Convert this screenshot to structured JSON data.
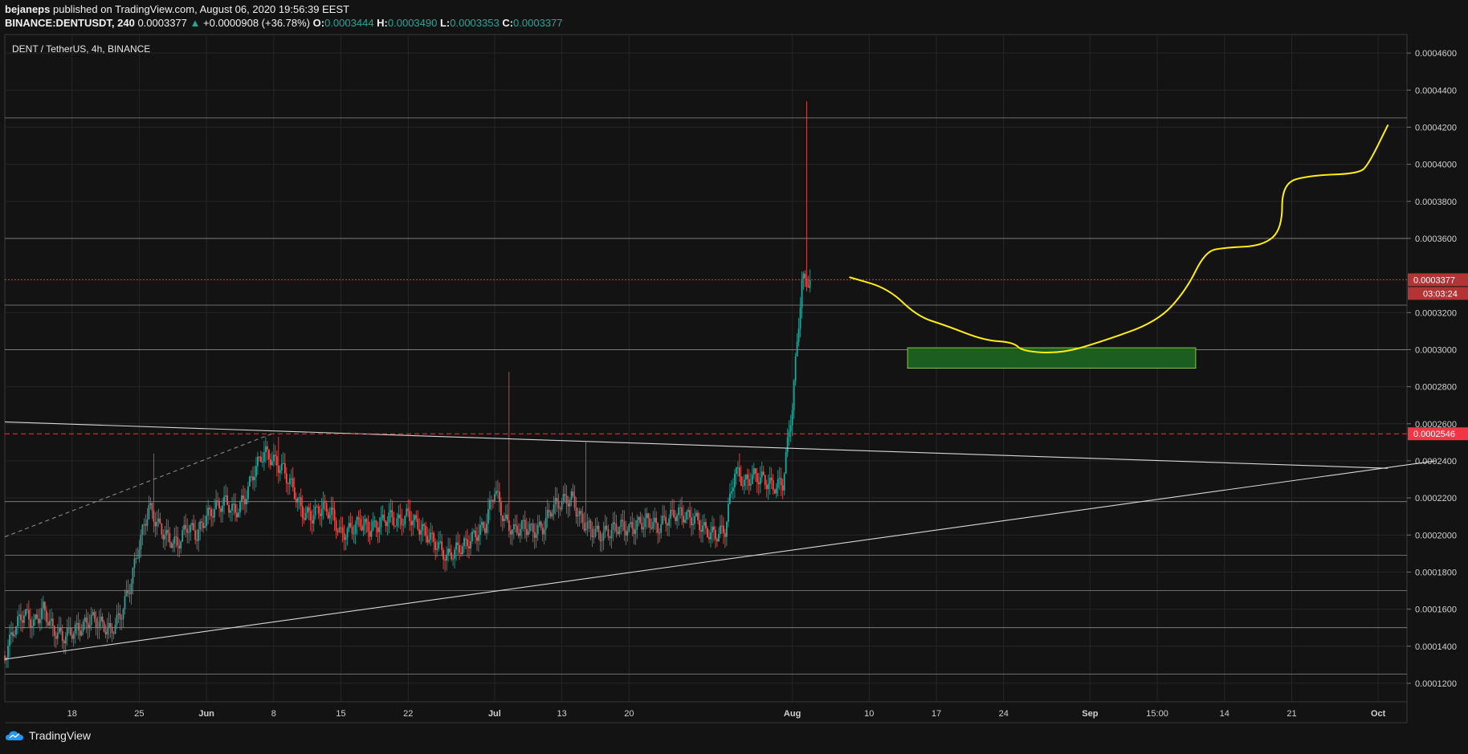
{
  "header": {
    "author": "bejaneps",
    "published_text": "published on TradingView.com, August 06, 2020 19:56:39 EEST",
    "symbol": "BINANCE:DENTUSDT, 240",
    "last": "0.0003377",
    "change": "+0.0000908 (+36.78%)",
    "o_label": "O:",
    "o_value": "0.0003444",
    "h_label": "H:",
    "h_value": "0.0003490",
    "l_label": "L:",
    "l_value": "0.0003353",
    "c_label": "C:",
    "c_value": "0.0003377"
  },
  "footer": {
    "brand": "TradingView"
  },
  "colors": {
    "background": "#131313",
    "grid": "#262626",
    "up": "#26a69a",
    "down": "#ef5350",
    "drawing_yellow": "#ffee10",
    "box_fill": "#1b5e20",
    "box_stroke": "#8bc34a",
    "price_label": "#b23434",
    "alert_red": "#f23645"
  },
  "chart_data": {
    "type": "candlestick",
    "title": "DENT / TetherUS, 4h, BINANCE",
    "xlabel": "",
    "ylabel": "",
    "ylim": [
      0.00011,
      0.00047
    ],
    "y_ticks": [
      "0.0004600",
      "0.0004400",
      "0.0004200",
      "0.0004000",
      "0.0003800",
      "0.0003600",
      "0.0003200",
      "0.0003000",
      "0.0002800",
      "0.0002600",
      "0.0002400",
      "0.0002200",
      "0.0002000",
      "0.0001800",
      "0.0001600",
      "0.0001400",
      "0.0001200"
    ],
    "y_tick_values": [
      0.00046,
      0.00044,
      0.00042,
      0.0004,
      0.00038,
      0.00036,
      0.00032,
      0.0003,
      0.00028,
      0.00026,
      0.00024,
      0.00022,
      0.0002,
      0.00018,
      0.00016,
      0.00014,
      0.00012
    ],
    "x_ticks": [
      "18",
      "25",
      "Jun",
      "8",
      "15",
      "22",
      "Jul",
      "13",
      "20",
      "Aug",
      "10",
      "17",
      "24",
      "Sep",
      "15:00",
      "14",
      "21",
      "Oct"
    ],
    "x_tick_days": [
      17,
      24,
      31,
      38,
      45,
      52,
      61,
      68,
      75,
      92,
      100,
      107,
      114,
      123,
      130,
      137,
      144,
      153
    ],
    "x_day_domain": [
      10,
      156
    ],
    "last_price": {
      "label": "0.0003377",
      "value": 0.0003377,
      "countdown": "03:03:24"
    },
    "alert_price": {
      "label": "0.0002546",
      "value": 0.0002546
    },
    "horizontal_levels": [
      0.000425,
      0.00036,
      0.000324,
      0.0003,
      0.000218,
      0.000189,
      0.00017,
      0.00015,
      0.000125
    ],
    "series_close": [
      [
        10,
        0.000135
      ],
      [
        11,
        0.00015
      ],
      [
        12,
        0.000158
      ],
      [
        13,
        0.000152
      ],
      [
        14,
        0.00016
      ],
      [
        15,
        0.000149
      ],
      [
        16,
        0.000145
      ],
      [
        17,
        0.000148
      ],
      [
        18,
        0.00015
      ],
      [
        19,
        0.000155
      ],
      [
        20,
        0.000152
      ],
      [
        21,
        0.000148
      ],
      [
        22,
        0.000156
      ],
      [
        23,
        0.000172
      ],
      [
        24,
        0.000195
      ],
      [
        25,
        0.000215
      ],
      [
        26,
        0.000205
      ],
      [
        27,
        0.000198
      ],
      [
        28,
        0.000195
      ],
      [
        29,
        0.000205
      ],
      [
        30,
        0.0002
      ],
      [
        31,
        0.00021
      ],
      [
        32,
        0.000215
      ],
      [
        33,
        0.000218
      ],
      [
        34,
        0.000212
      ],
      [
        35,
        0.00022
      ],
      [
        36,
        0.000235
      ],
      [
        37,
        0.000245
      ],
      [
        38,
        0.00024
      ],
      [
        39,
        0.000235
      ],
      [
        40,
        0.000225
      ],
      [
        41,
        0.000212
      ],
      [
        42,
        0.00021
      ],
      [
        43,
        0.000215
      ],
      [
        44,
        0.000212
      ],
      [
        45,
        0.0002
      ],
      [
        46,
        0.000203
      ],
      [
        47,
        0.000207
      ],
      [
        48,
        0.000203
      ],
      [
        49,
        0.000206
      ],
      [
        50,
        0.00021
      ],
      [
        51,
        0.000207
      ],
      [
        52,
        0.000211
      ],
      [
        53,
        0.000205
      ],
      [
        54,
        0.0002
      ],
      [
        55,
        0.000195
      ],
      [
        56,
        0.000188
      ],
      [
        57,
        0.000192
      ],
      [
        58,
        0.000195
      ],
      [
        59,
        0.0002
      ],
      [
        60,
        0.000205
      ],
      [
        61,
        0.000225
      ],
      [
        62,
        0.000208
      ],
      [
        63,
        0.000202
      ],
      [
        64,
        0.000205
      ],
      [
        65,
        0.000202
      ],
      [
        66,
        0.000204
      ],
      [
        67,
        0.000215
      ],
      [
        68,
        0.000218
      ],
      [
        69,
        0.00022
      ],
      [
        70,
        0.000208
      ],
      [
        71,
        0.000203
      ],
      [
        72,
        0.0002
      ],
      [
        73,
        0.000202
      ],
      [
        74,
        0.000205
      ],
      [
        75,
        0.000203
      ],
      [
        76,
        0.000206
      ],
      [
        77,
        0.000208
      ],
      [
        78,
        0.000204
      ],
      [
        79,
        0.000209
      ],
      [
        80,
        0.000212
      ],
      [
        81,
        0.00021
      ],
      [
        82,
        0.000208
      ],
      [
        83,
        0.000202
      ],
      [
        84,
        0.0002
      ],
      [
        85,
        0.000203
      ],
      [
        86,
        0.000235
      ],
      [
        87,
        0.000228
      ],
      [
        88,
        0.000232
      ],
      [
        89,
        0.00023
      ],
      [
        90,
        0.000226
      ],
      [
        91,
        0.000228
      ],
      [
        92,
        0.00027
      ],
      [
        93,
        0.000337
      ]
    ],
    "series_high": [
      [
        25,
        0.000244
      ],
      [
        38,
        0.000253
      ],
      [
        62,
        0.000288
      ],
      [
        70,
        0.00025
      ],
      [
        86,
        0.000244
      ],
      [
        93,
        0.000434
      ]
    ],
    "trendlines": [
      {
        "from": [
          10,
          0.000261
        ],
        "to": [
          154,
          0.000236
        ]
      },
      {
        "from": [
          10,
          0.000133
        ],
        "to": [
          159,
          0.00024
        ]
      },
      {
        "from": [
          10,
          0.000199
        ],
        "to": [
          38,
          0.000255
        ],
        "dashed": true
      }
    ],
    "target_box": {
      "from": [
        104,
        0.000301
      ],
      "to": [
        134,
        0.00029
      ]
    },
    "projection_path": [
      [
        98,
        0.000339
      ],
      [
        102,
        0.000333
      ],
      [
        105,
        0.000318
      ],
      [
        108,
        0.000313
      ],
      [
        112,
        0.000305
      ],
      [
        115,
        0.000304
      ],
      [
        116,
        0.000299
      ],
      [
        120,
        0.000298
      ],
      [
        124,
        0.000304
      ],
      [
        130,
        0.000315
      ],
      [
        133,
        0.000332
      ],
      [
        135,
        0.000353
      ],
      [
        137,
        0.000355
      ],
      [
        141,
        0.000356
      ],
      [
        143,
        0.000365
      ],
      [
        143,
        0.00039
      ],
      [
        146,
        0.000394
      ],
      [
        151,
        0.000395
      ],
      [
        152,
        0.0004
      ],
      [
        154,
        0.000421
      ]
    ]
  }
}
